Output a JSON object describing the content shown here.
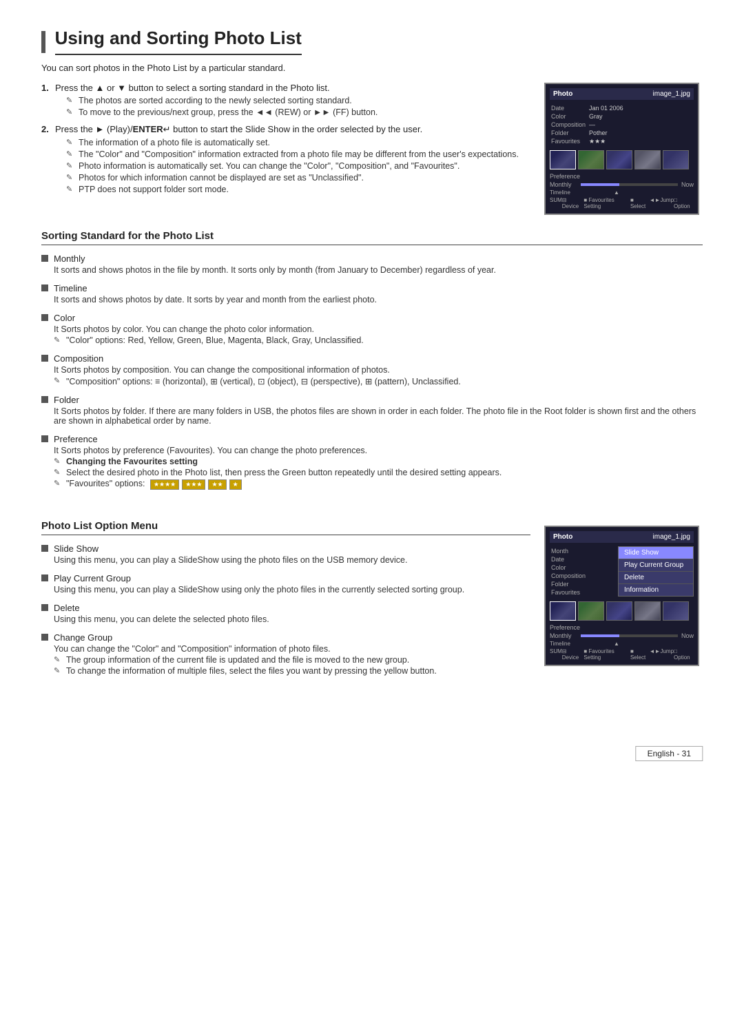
{
  "page": {
    "title": "Using and Sorting Photo List",
    "intro": "You can sort photos in the Photo List by a particular standard.",
    "steps": [
      {
        "num": "1.",
        "text": "Press the ▲ or ▼ button to select a sorting standard in the Photo list.",
        "notes": [
          "The photos are sorted according to the newly selected sorting standard.",
          "To move to the previous/next group, press the ◄◄ (REW) or ►► (FF) button."
        ]
      },
      {
        "num": "2.",
        "text": "Press the ► (Play)/ENTER↵ button to start the Slide Show in the order selected by the user.",
        "notes": [
          "The information of a photo file is automatically set.",
          "The \"Color\" and \"Composition\" information extracted from a photo file may be different from the user's expectations.",
          "Photo information is automatically set. You can change the \"Color\", \"Composition\", and \"Favourites\".",
          "Photos for which information cannot be displayed are set as \"Unclassified\".",
          "PTP does not support folder sort mode."
        ]
      }
    ],
    "sorting_section": {
      "heading": "Sorting Standard for the Photo List",
      "items": [
        {
          "title": "Monthly",
          "desc": "It sorts and shows photos in the file by month. It sorts only by month (from January to December) regardless of year.",
          "notes": []
        },
        {
          "title": "Timeline",
          "desc": "It sorts and shows photos by date. It sorts by year and month from the earliest photo.",
          "notes": []
        },
        {
          "title": "Color",
          "desc": "It Sorts photos by color. You can change the photo color information.",
          "notes": [
            "\"Color\" options: Red, Yellow, Green, Blue, Magenta, Black, Gray, Unclassified."
          ]
        },
        {
          "title": "Composition",
          "desc": "It Sorts photos by composition. You can change the compositional information of photos.",
          "notes": [
            "\"Composition\" options: ≡ (horizontal), ⊞ (vertical), ⊡ (object), ⊟ (perspective), ⊞ (pattern), Unclassified."
          ]
        },
        {
          "title": "Folder",
          "desc": "It Sorts photos by folder. If there are many folders in USB, the photos files are shown in order in each folder. The photo file in the Root folder is shown first and the others are shown in alphabetical order by name.",
          "notes": []
        },
        {
          "title": "Preference",
          "desc": "It Sorts photos by preference (Favourites). You can change the photo preferences.",
          "sub_items": [
            {
              "bold": true,
              "label": "Changing the Favourites setting",
              "note": true
            },
            {
              "bold": false,
              "label": "Select the desired photo in the Photo list, then press the Green button repeatedly until the desired setting appears.",
              "note": true
            },
            {
              "bold": false,
              "label": "\"Favourites\" options: ★★★★, ★★★, ★★, ★",
              "note": true,
              "is_fav": true
            }
          ]
        }
      ]
    },
    "option_menu_section": {
      "heading": "Photo List Option Menu",
      "items": [
        {
          "title": "Slide Show",
          "desc": "Using this menu, you can play a SlideShow using the photo files on the USB memory device."
        },
        {
          "title": "Play Current Group",
          "desc": "Using this menu, you can play a SlideShow using only the photo files in the currently selected sorting group."
        },
        {
          "title": "Delete",
          "desc": "Using this menu, you can delete the selected photo files."
        },
        {
          "title": "Change Group",
          "desc": "You can change the \"Color\" and \"Composition\" information of photo files.",
          "notes": [
            "The group information of the current file is updated and the file is moved to the new group.",
            "To change the information of multiple files, select the files you want by pressing the yellow button."
          ]
        }
      ]
    },
    "footer": {
      "text": "English - 31"
    }
  }
}
